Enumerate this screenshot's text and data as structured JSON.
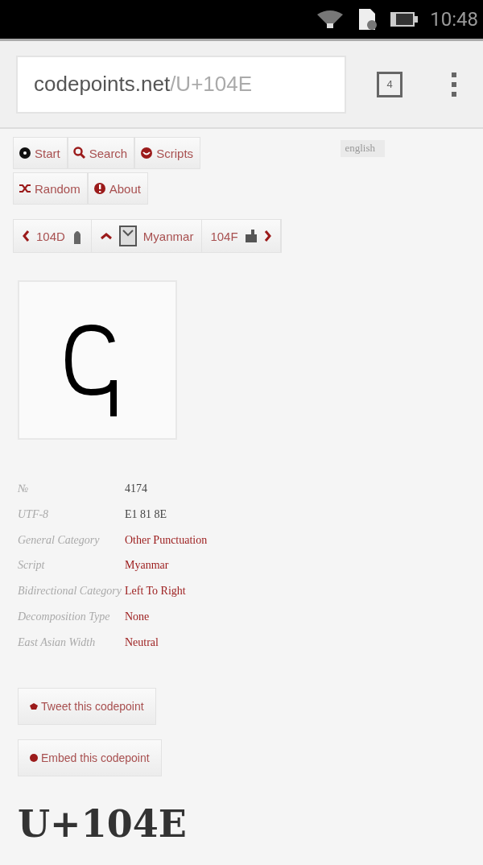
{
  "status_bar": {
    "time": "10:48"
  },
  "browser": {
    "url_host": "codepoints.net",
    "url_path": "/U+104E",
    "tab_count": "4"
  },
  "nav": [
    {
      "label": "Start"
    },
    {
      "label": "Search"
    },
    {
      "label": "Scripts"
    },
    {
      "label": "Random"
    },
    {
      "label": "About"
    }
  ],
  "language": "english",
  "pager": {
    "prev": "104D",
    "up": "Myanmar",
    "next": "104F"
  },
  "properties": [
    {
      "label": "№",
      "value": "4174",
      "link": false
    },
    {
      "label": "UTF-8",
      "value": "E1 81 8E",
      "link": false
    },
    {
      "label": "General Category",
      "value": "Other Punctuation",
      "link": true
    },
    {
      "label": "Script",
      "value": "Myanmar",
      "link": true
    },
    {
      "label": "Bidirectional Category",
      "value": "Left To Right",
      "link": true
    },
    {
      "label": "Decomposition Type",
      "value": "None",
      "link": true
    },
    {
      "label": "East Asian Width",
      "value": "Neutral",
      "link": true
    }
  ],
  "actions": [
    "Tweet this codepoint",
    "Embed this codepoint"
  ],
  "heading": "U+104E"
}
